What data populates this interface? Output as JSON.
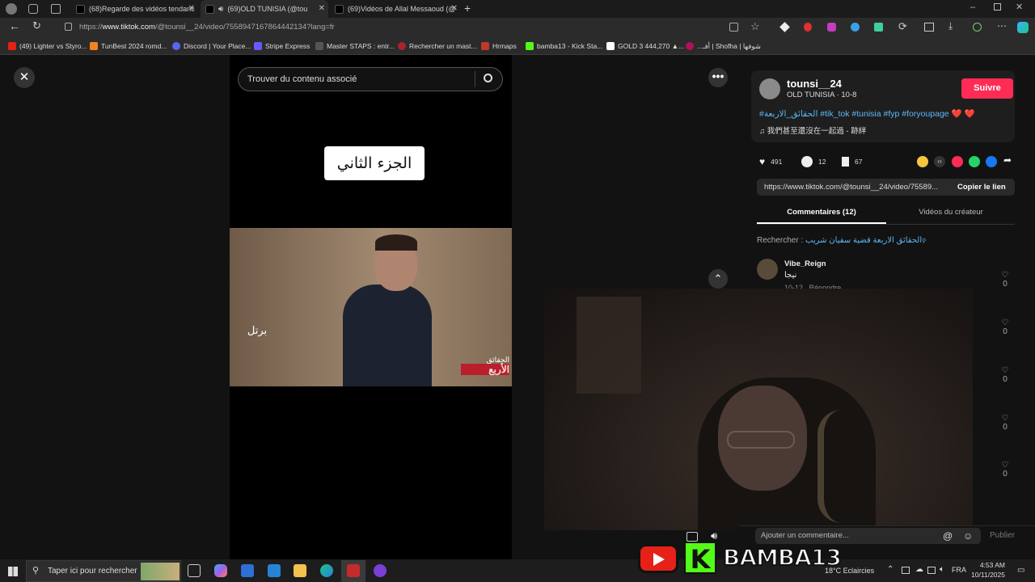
{
  "browser": {
    "tabs": [
      {
        "label": "(68)Regarde des vidéos tendanc"
      },
      {
        "label": "(69)OLD TUNISIA (@tounsi_"
      },
      {
        "label": "(69)Vidéos de Allal Messaoud (@"
      }
    ],
    "url_prefix": "https://",
    "url_domain": "www.tiktok.com",
    "url_rest": "/@tounsi__24/video/7558947167864442134?lang=fr",
    "bookmarks": [
      {
        "label": "(49) Lighter vs Styro...",
        "color": "#e62117"
      },
      {
        "label": "TunBest 2024 romd...",
        "color": "#f58220"
      },
      {
        "label": "Discord | Your Place...",
        "color": "#5865f2"
      },
      {
        "label": "Stripe Express",
        "color": "#635bff"
      },
      {
        "label": "Master STAPS : entr...",
        "color": "#555555"
      },
      {
        "label": "Rechercher un mast...",
        "color": "#aa2233"
      },
      {
        "label": "Hrmaps",
        "color": "#c0392b"
      },
      {
        "label": "bamba13 - Kick Sta...",
        "color": "#53fc18"
      },
      {
        "label": "GOLD 3 444,270 ▲...",
        "color": "#222222"
      },
      {
        "label": "...أفـ | Shofha | شوفها",
        "color": "#b01060"
      }
    ]
  },
  "player": {
    "search_placeholder": "Trouver du contenu associé",
    "overlay_title": "الجزء الثاني",
    "frame_caption1": "الحقائق",
    "frame_caption2": "الأربع"
  },
  "post": {
    "username": "tounsi__24",
    "subtitle": "OLD TUNISIA · 10-8",
    "follow_label": "Suivre",
    "hashtags": "#الحقائق_الاربعة #tik_tok #tunisia #fyp #foryoupage ❤️ ❤️",
    "music": "我們甚至還沒在一起過 - 跡絆",
    "likes": "491",
    "comments": "12",
    "saves": "67",
    "link": "https://www.tiktok.com/@tounsi__24/video/75589...",
    "copy_label": "Copier le lien",
    "tab_comments": "Commentaires (12)",
    "tab_videos": "Vidéos du créateur",
    "search_label": "Rechercher :",
    "search_query": "الحقائق الاربعة قضية سفيان شريب",
    "comment_user": "Vibe_Reign",
    "comment_text": "نيجا",
    "comment_date": "10-12",
    "reply_label": "Répondre",
    "like_counts": [
      "0",
      "0",
      "0",
      "0",
      "0"
    ],
    "add_comment_placeholder": "Ajouter un commentaire...",
    "publish_label": "Publier"
  },
  "overlay": {
    "brand": "BAMBA13",
    "k_letter": "K"
  },
  "taskbar": {
    "search_placeholder": "Taper ici pour rechercher",
    "weather": "18°C  Eclaircies",
    "lang": "FRA",
    "time": "4:53 AM",
    "date": "10/11/2025"
  }
}
